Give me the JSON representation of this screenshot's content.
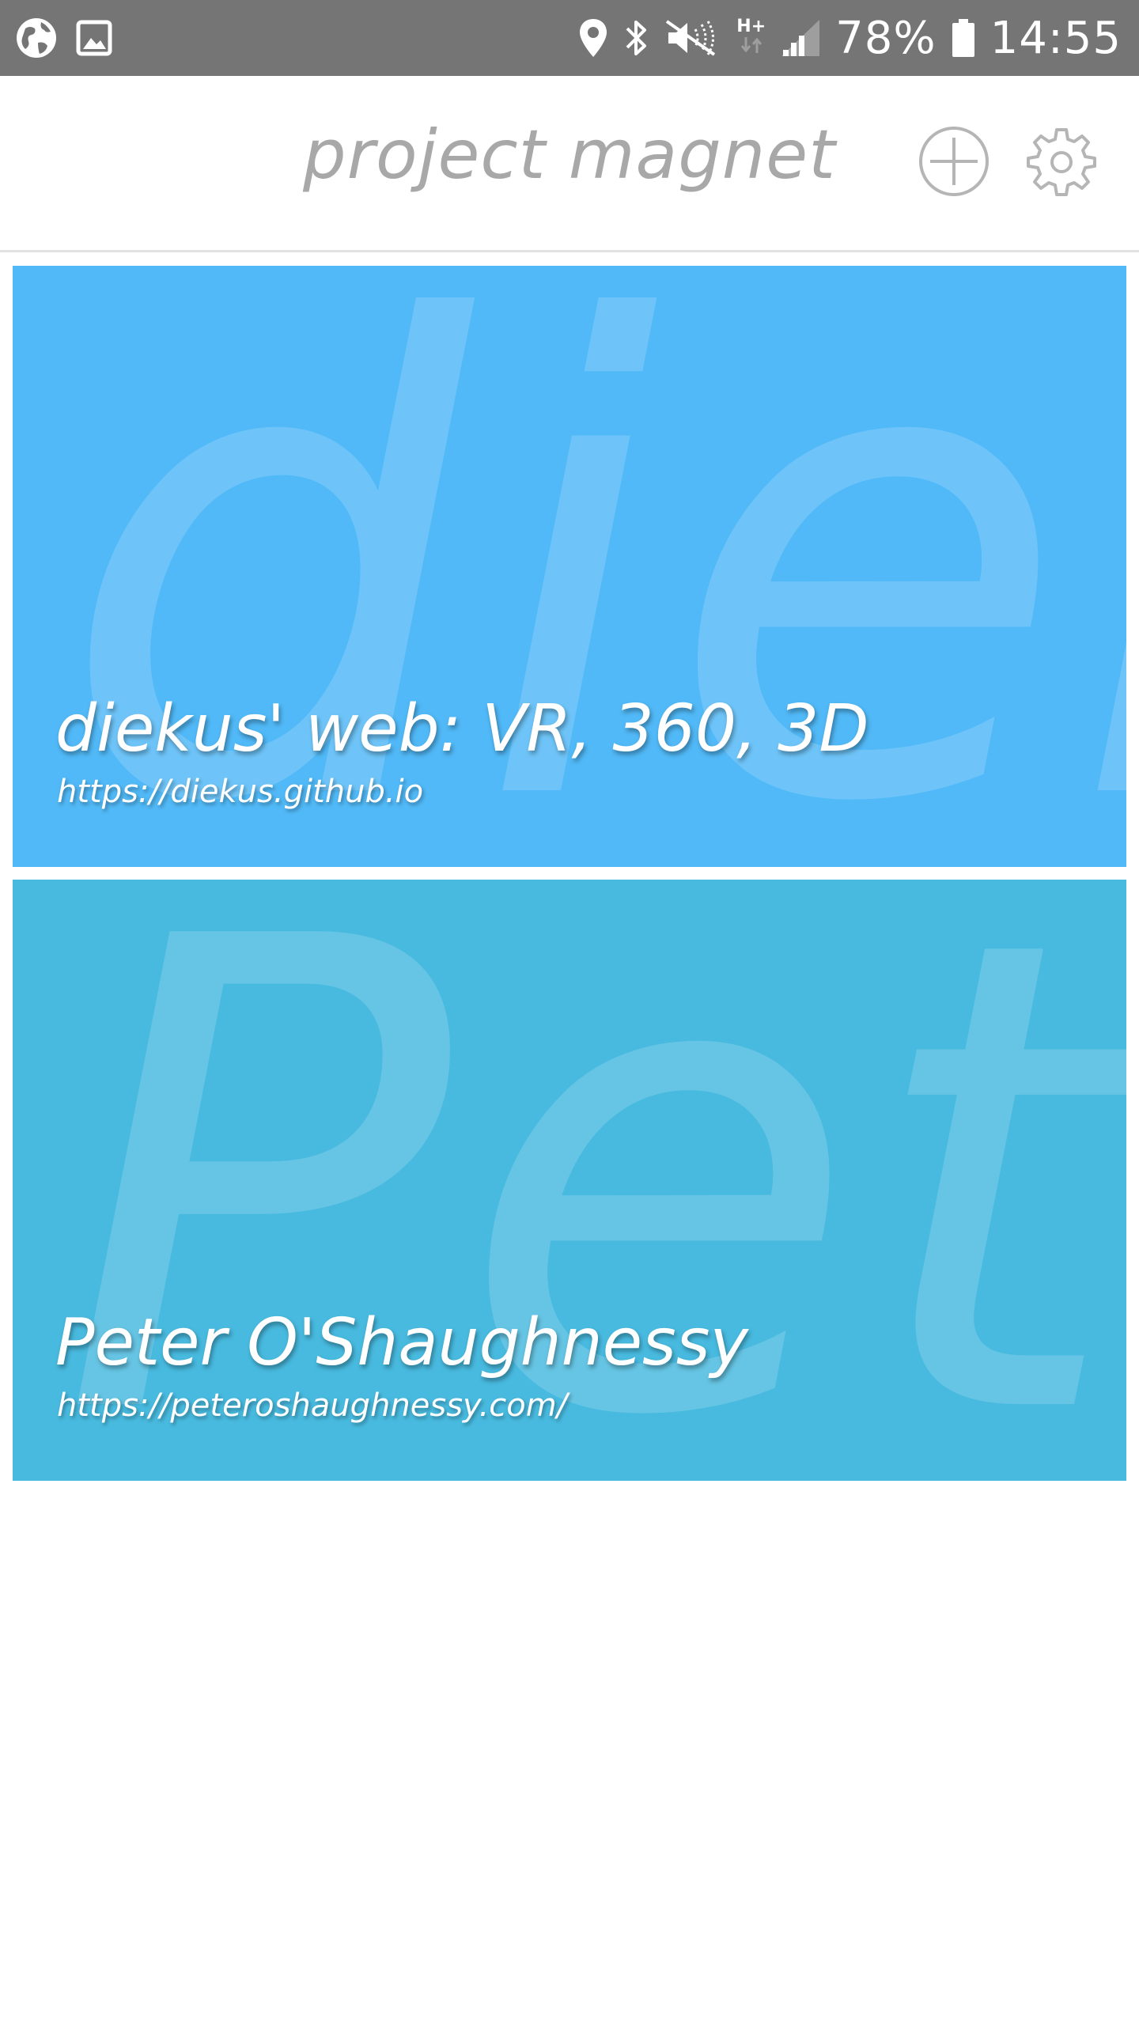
{
  "status_bar": {
    "left_icons": [
      "globe-icon",
      "image-icon"
    ],
    "right_icons": [
      "location-icon",
      "bluetooth-icon",
      "mute-icon",
      "network-hplus-icon",
      "signal-icon",
      "battery-icon"
    ],
    "network_type": "H+",
    "battery_percent": "78%",
    "time": "14:55"
  },
  "app_bar": {
    "title": "project magnet",
    "add_icon": "add-circle-icon",
    "settings_icon": "gear-icon"
  },
  "cards": [
    {
      "background_text": "diek",
      "title": "diekus' web: VR, 360, 3D",
      "url": "https://diekus.github.io",
      "color": "#51b9f7"
    },
    {
      "background_text": "Pete",
      "title": "Peter O'Shaughnessy",
      "url": "https://peteroshaughnessy.com/",
      "color": "#48badf"
    }
  ],
  "colors": {
    "status_bar": "#757575",
    "title_text": "#a8a8a8",
    "divider": "#e3e3e3"
  }
}
